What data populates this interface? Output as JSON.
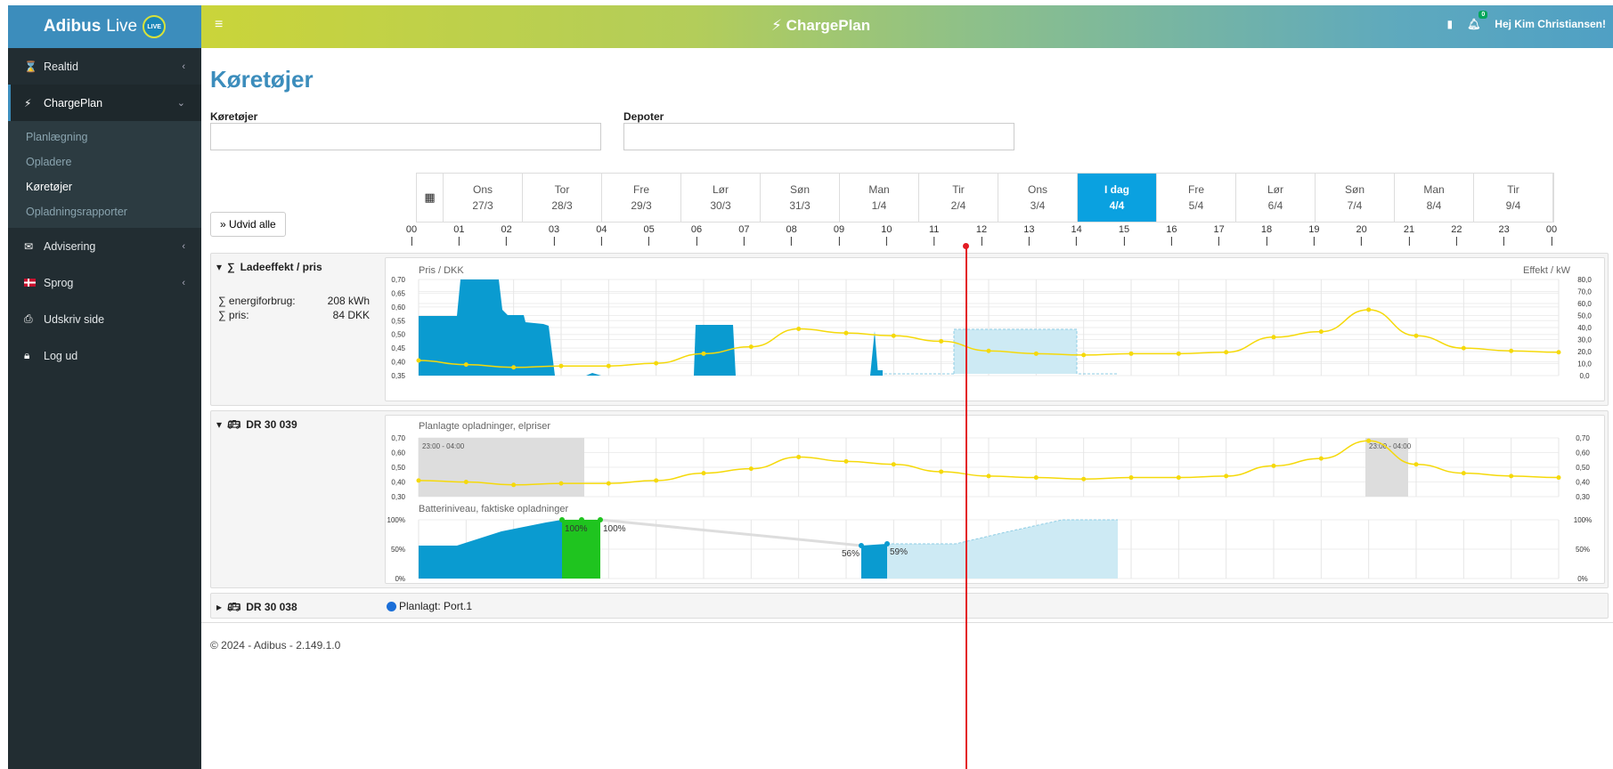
{
  "brand": {
    "name_bold": "Adibus",
    "name_rest": "Live",
    "live": "LIVE"
  },
  "sidebar": {
    "items": [
      {
        "label": "Realtid",
        "icon": "hourglass-icon"
      },
      {
        "label": "ChargePlan",
        "icon": "plug-icon"
      },
      {
        "label": "Advisering",
        "icon": "envelope-icon"
      },
      {
        "label": "Sprog",
        "icon": "danish-flag-icon"
      },
      {
        "label": "Udskriv side",
        "icon": "print-icon"
      },
      {
        "label": "Log ud",
        "icon": "lock-icon"
      }
    ],
    "sub": [
      "Planlægning",
      "Opladere",
      "Køretøjer",
      "Opladningsrapporter"
    ]
  },
  "topbar": {
    "title": "ChargePlan",
    "greeting": "Hej Kim Christiansen!",
    "bell_count": "0"
  },
  "page": {
    "title": "Køretøjer",
    "vehicles_label": "Køretøjer",
    "depots_label": "Depoter",
    "expand_button": "Udvid alle"
  },
  "days": [
    [
      "Ons",
      "27/3"
    ],
    [
      "Tor",
      "28/3"
    ],
    [
      "Fre",
      "29/3"
    ],
    [
      "Lør",
      "30/3"
    ],
    [
      "Søn",
      "31/3"
    ],
    [
      "Man",
      "1/4"
    ],
    [
      "Tir",
      "2/4"
    ],
    [
      "Ons",
      "3/4"
    ],
    [
      "I dag",
      "4/4"
    ],
    [
      "Fre",
      "5/4"
    ],
    [
      "Lør",
      "6/4"
    ],
    [
      "Søn",
      "7/4"
    ],
    [
      "Man",
      "8/4"
    ],
    [
      "Tir",
      "9/4"
    ]
  ],
  "hours": [
    "00",
    "01",
    "02",
    "03",
    "04",
    "05",
    "06",
    "07",
    "08",
    "09",
    "10",
    "11",
    "12",
    "13",
    "14",
    "15",
    "16",
    "17",
    "18",
    "19",
    "20",
    "21",
    "22",
    "23",
    "00"
  ],
  "summary": {
    "title": "Ladeeffekt / pris",
    "energy_label": "∑ energiforbrug:",
    "energy_value": "208 kWh",
    "price_label": "∑ pris:",
    "price_value": "84 DKK"
  },
  "vehicle1": {
    "name": "DR 30 039",
    "plan_title": "Planlagte opladninger, elpriser",
    "night_window": "23:00 - 04:00",
    "battery_title": "Batteriniveau, faktiske opladninger",
    "labels": [
      "100%",
      "100%",
      "56%",
      "59%"
    ]
  },
  "vehicle2": {
    "name": "DR 30 038",
    "status": "Planlagt: Port.1"
  },
  "footer": "© 2024 - Adibus - 2.149.1.0",
  "chart_data": [
    {
      "type": "line",
      "title": "",
      "ylabel": "Pris / DKK",
      "y2label": "Effekt / kW",
      "ylim": [
        0.35,
        0.7
      ],
      "y2lim": [
        0,
        80
      ],
      "yticks": [
        "0,70",
        "0,65",
        "0,60",
        "0,55",
        "0,50",
        "0,45",
        "0,40",
        "0,35"
      ],
      "y2ticks": [
        "80,0",
        "70,0",
        "60,0",
        "50,0",
        "40,0",
        "30,0",
        "20,0",
        "10,0",
        "0,0"
      ],
      "x": [
        0,
        1,
        2,
        3,
        4,
        5,
        6,
        7,
        8,
        9,
        10,
        11,
        12,
        13,
        14,
        15,
        16,
        17,
        18,
        19,
        20,
        21,
        22,
        23,
        24
      ],
      "series": [
        {
          "values": [
            0.405,
            0.39,
            0.38,
            0.385,
            0.385,
            0.395,
            0.43,
            0.455,
            0.52,
            0.505,
            0.495,
            0.475,
            0.44,
            0.43,
            0.425,
            0.43,
            0.43,
            0.435,
            0.49,
            0.51,
            0.59,
            0.495,
            0.45,
            0.44,
            0.435
          ]
        }
      ]
    },
    {
      "type": "line",
      "title": "",
      "ylim": [
        0.3,
        0.7
      ],
      "yticks": [
        "0,70",
        "0,60",
        "0,50",
        "0,40",
        "0,30"
      ],
      "x": [
        0,
        1,
        2,
        3,
        4,
        5,
        6,
        7,
        8,
        9,
        10,
        11,
        12,
        13,
        14,
        15,
        16,
        17,
        18,
        19,
        20,
        21,
        22,
        23,
        24
      ],
      "series": [
        {
          "values": [
            0.41,
            0.4,
            0.38,
            0.39,
            0.39,
            0.41,
            0.46,
            0.49,
            0.57,
            0.54,
            0.52,
            0.47,
            0.44,
            0.43,
            0.42,
            0.43,
            0.43,
            0.44,
            0.51,
            0.56,
            0.68,
            0.52,
            0.46,
            0.44,
            0.43
          ]
        }
      ]
    },
    {
      "type": "area",
      "title": "",
      "yticks": [
        "100%",
        "50%",
        "0%"
      ],
      "series": [
        {
          "values": [
            [
              0,
              55
            ],
            [
              1,
              55
            ],
            [
              2,
              70
            ],
            [
              3,
              85
            ],
            [
              3.5,
              100
            ],
            [
              4.5,
              100
            ]
          ]
        },
        {
          "values": [
            [
              10.8,
              56
            ],
            [
              11.5,
              59
            ]
          ]
        }
      ]
    }
  ]
}
